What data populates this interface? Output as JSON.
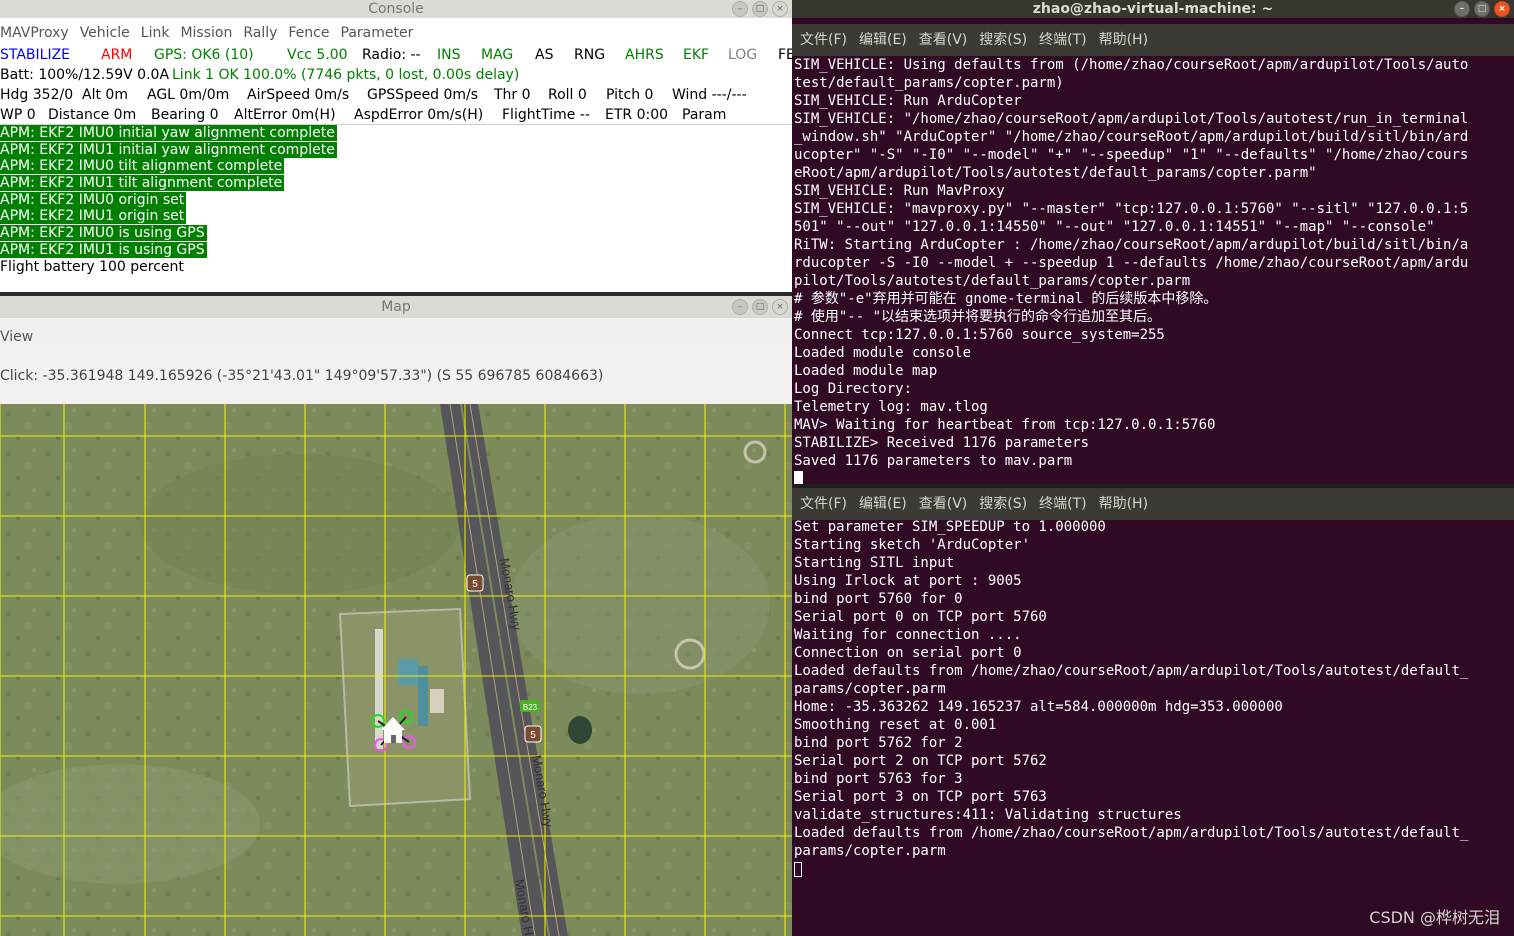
{
  "console": {
    "title": "Console",
    "menu": [
      "MAVProxy",
      "Vehicle",
      "Link",
      "Mission",
      "Rally",
      "Fence",
      "Parameter"
    ],
    "row1": [
      {
        "text": "STABILIZE",
        "color": "#0000ff"
      },
      {
        "text": "ARM",
        "color": "#ff0000"
      },
      {
        "text": "GPS: OK6 (10)",
        "color": "#008000"
      },
      {
        "text": "Vcc 5.00",
        "color": "#008000"
      },
      {
        "text": "Radio: --",
        "color": "#000000"
      },
      {
        "text": "INS",
        "color": "#008000"
      },
      {
        "text": "MAG",
        "color": "#008000"
      },
      {
        "text": "AS",
        "color": "#000000"
      },
      {
        "text": "RNG",
        "color": "#000000"
      },
      {
        "text": "AHRS",
        "color": "#008000"
      },
      {
        "text": "EKF",
        "color": "#008000"
      },
      {
        "text": "LOG",
        "color": "#808080"
      },
      {
        "text": "FE",
        "color": "#000000"
      }
    ],
    "row2": [
      {
        "text": "Batt: 100%/12.59V 0.0A",
        "color": "#000000"
      },
      {
        "text": "Link 1 OK 100.0% (7746 pkts, 0 lost, 0.00s delay)",
        "color": "#008000"
      }
    ],
    "row3": [
      {
        "text": "Hdg 352/0",
        "color": "#000000"
      },
      {
        "text": "Alt 0m",
        "color": "#000000"
      },
      {
        "text": "AGL 0m/0m",
        "color": "#000000"
      },
      {
        "text": "AirSpeed 0m/s",
        "color": "#000000"
      },
      {
        "text": "GPSSpeed 0m/s",
        "color": "#000000"
      },
      {
        "text": "Thr 0",
        "color": "#000000"
      },
      {
        "text": "Roll 0",
        "color": "#000000"
      },
      {
        "text": "Pitch 0",
        "color": "#000000"
      },
      {
        "text": "Wind ---/---",
        "color": "#000000"
      }
    ],
    "row4": [
      {
        "text": "WP 0",
        "color": "#000000"
      },
      {
        "text": "Distance 0m",
        "color": "#000000"
      },
      {
        "text": "Bearing 0",
        "color": "#000000"
      },
      {
        "text": "AltError 0m(H)",
        "color": "#000000"
      },
      {
        "text": "AspdError 0m/s(H)",
        "color": "#000000"
      },
      {
        "text": "FlightTime --",
        "color": "#000000"
      },
      {
        "text": "ETR 0:00",
        "color": "#000000"
      },
      {
        "text": "Param",
        "color": "#000000"
      }
    ],
    "messages": [
      {
        "text": "APM: EKF2 IMU0 initial yaw alignment complete",
        "style": "green"
      },
      {
        "text": "APM: EKF2 IMU1 initial yaw alignment complete",
        "style": "green"
      },
      {
        "text": "APM: EKF2 IMU0 tilt alignment complete",
        "style": "green"
      },
      {
        "text": "APM: EKF2 IMU1 tilt alignment complete",
        "style": "green"
      },
      {
        "text": "APM: EKF2 IMU0 origin set",
        "style": "green"
      },
      {
        "text": "APM: EKF2 IMU1 origin set",
        "style": "green"
      },
      {
        "text": "APM: EKF2 IMU0 is using GPS",
        "style": "green"
      },
      {
        "text": "APM: EKF2 IMU1 is using GPS",
        "style": "green"
      },
      {
        "text": "Flight battery 100 percent",
        "style": "plain"
      }
    ]
  },
  "map": {
    "title": "Map",
    "view_menu": "View",
    "click_info": "Click: -35.361948 149.165926 (-35°21'43.01\" 149°09'57.33\") (S 55 696785 6084663)",
    "road_labels": [
      "Monaro Hwy",
      "Monaro Hwy",
      "Monaro H"
    ],
    "route_shields": [
      "5",
      "5"
    ],
    "b_road_shield": "B23"
  },
  "terminal": {
    "title": "zhao@zhao-virtual-machine: ~",
    "menu": [
      "文件(F)",
      "编辑(E)",
      "查看(V)",
      "搜索(S)",
      "终端(T)",
      "帮助(H)"
    ],
    "top_lines": [
      "SIM_VEHICLE: Using defaults from (/home/zhao/courseRoot/apm/ardupilot/Tools/auto",
      "test/default_params/copter.parm)",
      "SIM_VEHICLE: Run ArduCopter",
      "SIM_VEHICLE: \"/home/zhao/courseRoot/apm/ardupilot/Tools/autotest/run_in_terminal",
      "_window.sh\" \"ArduCopter\" \"/home/zhao/courseRoot/apm/ardupilot/build/sitl/bin/ard",
      "ucopter\" \"-S\" \"-I0\" \"--model\" \"+\" \"--speedup\" \"1\" \"--defaults\" \"/home/zhao/cours",
      "eRoot/apm/ardupilot/Tools/autotest/default_params/copter.parm\"",
      "SIM_VEHICLE: Run MavProxy",
      "SIM_VEHICLE: \"mavproxy.py\" \"--master\" \"tcp:127.0.0.1:5760\" \"--sitl\" \"127.0.0.1:5",
      "501\" \"--out\" \"127.0.0.1:14550\" \"--out\" \"127.0.0.1:14551\" \"--map\" \"--console\"",
      "RiTW: Starting ArduCopter : /home/zhao/courseRoot/apm/ardupilot/build/sitl/bin/a",
      "rducopter -S -I0 --model + --speedup 1 --defaults /home/zhao/courseRoot/apm/ardu",
      "pilot/Tools/autotest/default_params/copter.parm",
      "# 参数\"-e\"弃用并可能在 gnome-terminal 的后续版本中移除。",
      "# 使用\"-- \"以结束选项并将要执行的命令行追加至其后。",
      "Connect tcp:127.0.0.1:5760 source_system=255",
      "Loaded module console",
      "Loaded module map",
      "Log Directory:",
      "Telemetry log: mav.tlog",
      "MAV> Waiting for heartbeat from tcp:127.0.0.1:5760",
      "STABILIZE> Received 1176 parameters",
      "Saved 1176 parameters to mav.parm"
    ],
    "bottom_lines": [
      "Set parameter SIM_SPEEDUP to 1.000000",
      "Starting sketch 'ArduCopter'",
      "Starting SITL input",
      "Using Irlock at port : 9005",
      "bind port 5760 for 0",
      "Serial port 0 on TCP port 5760",
      "Waiting for connection ....",
      "Connection on serial port 0",
      "Loaded defaults from /home/zhao/courseRoot/apm/ardupilot/Tools/autotest/default_",
      "params/copter.parm",
      "Home: -35.363262 149.165237 alt=584.000000m hdg=353.000000",
      "Smoothing reset at 0.001",
      "bind port 5762 for 2",
      "Serial port 2 on TCP port 5762",
      "bind port 5763 for 3",
      "Serial port 3 on TCP port 5763",
      "validate_structures:411: Validating structures",
      "Loaded defaults from /home/zhao/courseRoot/apm/ardupilot/Tools/autotest/default_",
      "params/copter.parm"
    ],
    "watermark": "CSDN @桦树无泪"
  }
}
